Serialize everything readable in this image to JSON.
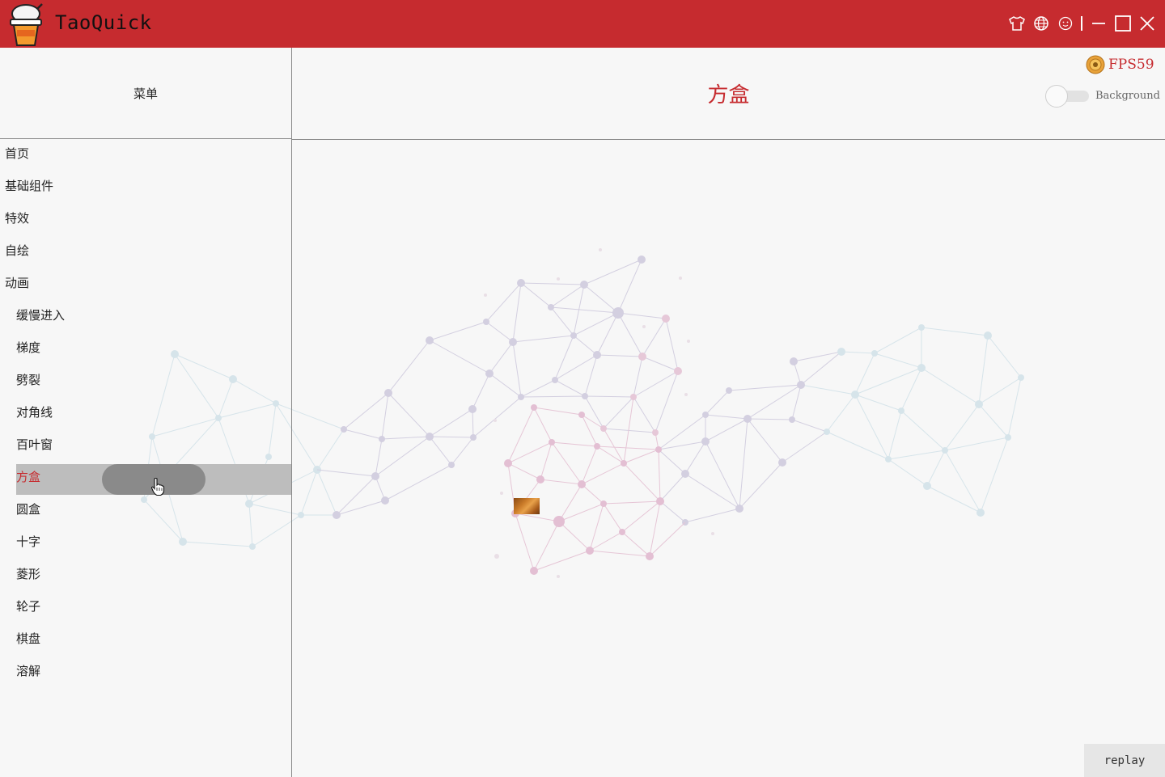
{
  "titlebar": {
    "app_title": "TaoQuick",
    "background_color": "#c62b2f",
    "icons": [
      "shirt-icon",
      "globe-icon",
      "smiley-icon",
      "minimize-icon",
      "maximize-icon",
      "close-icon"
    ]
  },
  "sidebar": {
    "header": "菜单",
    "items": [
      {
        "label": "首页",
        "level": 0
      },
      {
        "label": "基础组件",
        "level": 0
      },
      {
        "label": "特效",
        "level": 0
      },
      {
        "label": "自绘",
        "level": 0
      },
      {
        "label": "动画",
        "level": 0
      },
      {
        "label": "缓慢进入",
        "level": 1
      },
      {
        "label": "梯度",
        "level": 1
      },
      {
        "label": "劈裂",
        "level": 1
      },
      {
        "label": "对角线",
        "level": 1
      },
      {
        "label": "百叶窗",
        "level": 1
      },
      {
        "label": "方盒",
        "level": 1,
        "selected": true
      },
      {
        "label": "圆盒",
        "level": 1
      },
      {
        "label": "十字",
        "level": 1
      },
      {
        "label": "菱形",
        "level": 1
      },
      {
        "label": "轮子",
        "level": 1
      },
      {
        "label": "棋盘",
        "level": 1
      },
      {
        "label": "溶解",
        "level": 1
      }
    ],
    "selected_color": "#c62b2f"
  },
  "header": {
    "title": "方盒",
    "fps_label": "FPS59",
    "background_toggle_label": "Background",
    "background_toggle_on": false
  },
  "footer": {
    "replay_label": "replay"
  },
  "colors": {
    "accent": "#c62b2f",
    "network_blue": "#c9dde3",
    "network_purple": "#cfc6d9",
    "network_pink": "#e3bfd3"
  }
}
